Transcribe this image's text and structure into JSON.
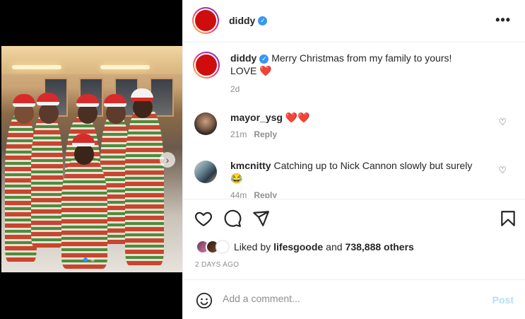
{
  "post": {
    "author": "diddy",
    "verified": true,
    "caption": "Merry Christmas from my family to yours!",
    "caption_line2": "LOVE",
    "caption_emoji": "❤️",
    "caption_age": "2d",
    "media_index": 1,
    "media_count": 2
  },
  "comments": [
    {
      "user": "mayor_ysg",
      "text": "❤️❤️",
      "age": "21m",
      "reply": "Reply"
    },
    {
      "user": "kmcnitty",
      "text": "Catching up to Nick Cannon slowly but surely",
      "text_emoji": "😂",
      "age": "44m",
      "reply": "Reply"
    }
  ],
  "likes": {
    "prefix": "Liked by",
    "first_user": "lifesgoode",
    "joiner": "and",
    "count_text": "738,888 others"
  },
  "timestamp": "2 DAYS AGO",
  "add_comment": {
    "placeholder": "Add a comment...",
    "post_label": "Post"
  },
  "icons": {
    "more": "more-horizontal-icon",
    "like": "heart-icon",
    "comment": "comment-bubble-icon",
    "share": "paper-plane-icon",
    "save": "bookmark-icon",
    "emoji": "smiley-icon"
  },
  "colors": {
    "verified": "#3897f0",
    "post_disabled": "#b2dffc",
    "carousel_dot": "#2f97f6",
    "avatar": "#d00d0d"
  }
}
